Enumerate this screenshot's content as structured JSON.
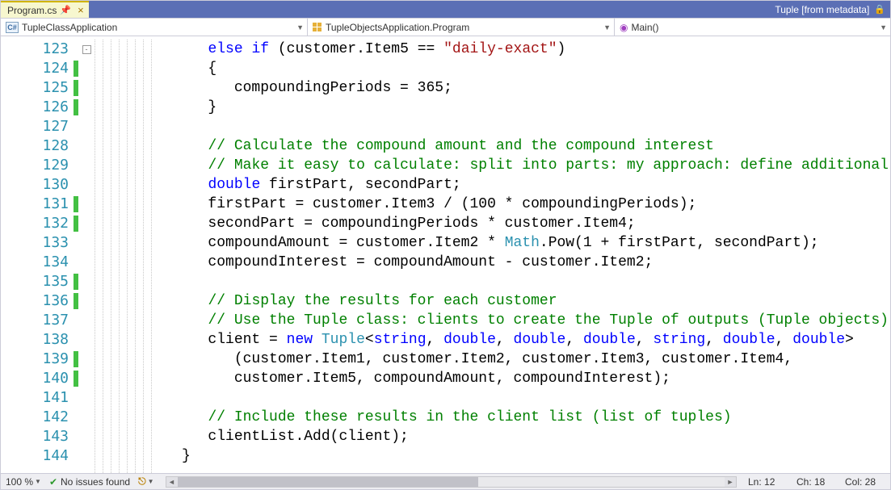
{
  "tab": {
    "filename": "Program.cs"
  },
  "titlebar_right": "Tuple [from metadata]",
  "nav": {
    "seg1": "TupleClassApplication",
    "seg2": "TupleObjectsApplication.Program",
    "seg3": "Main()"
  },
  "lines": {
    "start": 123,
    "end": 144,
    "marked": [
      124,
      125,
      126,
      131,
      132,
      135,
      136,
      139,
      140
    ]
  },
  "code": [
    {
      "tokens": [
        {
          "t": "             "
        },
        {
          "t": "else if",
          "c": "kw"
        },
        {
          "t": " (customer.Item5 == "
        },
        {
          "t": "\"daily-exact\"",
          "c": "str"
        },
        {
          "t": ")"
        }
      ]
    },
    {
      "tokens": [
        {
          "t": "             {"
        }
      ]
    },
    {
      "tokens": [
        {
          "t": "                compoundingPeriods = 365;"
        }
      ]
    },
    {
      "tokens": [
        {
          "t": "             }"
        }
      ]
    },
    {
      "tokens": [
        {
          "t": ""
        }
      ]
    },
    {
      "tokens": [
        {
          "t": "             "
        },
        {
          "t": "// Calculate the compound amount and the compound interest",
          "c": "cm"
        }
      ]
    },
    {
      "tokens": [
        {
          "t": "             "
        },
        {
          "t": "// Make it easy to calculate: split into parts: my approach: define additional fields here",
          "c": "cm"
        }
      ]
    },
    {
      "tokens": [
        {
          "t": "             "
        },
        {
          "t": "double",
          "c": "kw"
        },
        {
          "t": " firstPart, secondPart;"
        }
      ]
    },
    {
      "tokens": [
        {
          "t": "             firstPart = customer.Item3 / (100 * compoundingPeriods);"
        }
      ]
    },
    {
      "tokens": [
        {
          "t": "             secondPart = compoundingPeriods * customer.Item4;"
        }
      ]
    },
    {
      "tokens": [
        {
          "t": "             compoundAmount = customer.Item2 * "
        },
        {
          "t": "Math",
          "c": "typ"
        },
        {
          "t": ".Pow(1 + firstPart, secondPart);"
        }
      ]
    },
    {
      "tokens": [
        {
          "t": "             compoundInterest = compoundAmount - customer.Item2;"
        }
      ]
    },
    {
      "tokens": [
        {
          "t": ""
        }
      ]
    },
    {
      "tokens": [
        {
          "t": "             "
        },
        {
          "t": "// Display the results for each customer",
          "c": "cm"
        }
      ]
    },
    {
      "tokens": [
        {
          "t": "             "
        },
        {
          "t": "// Use the Tuple class: clients to create the Tuple of outputs (Tuple objects)",
          "c": "cm"
        }
      ]
    },
    {
      "tokens": [
        {
          "t": "             client = "
        },
        {
          "t": "new",
          "c": "kw"
        },
        {
          "t": " "
        },
        {
          "t": "Tuple",
          "c": "typ"
        },
        {
          "t": "<"
        },
        {
          "t": "string",
          "c": "kw"
        },
        {
          "t": ", "
        },
        {
          "t": "double",
          "c": "kw"
        },
        {
          "t": ", "
        },
        {
          "t": "double",
          "c": "kw"
        },
        {
          "t": ", "
        },
        {
          "t": "double",
          "c": "kw"
        },
        {
          "t": ", "
        },
        {
          "t": "string",
          "c": "kw"
        },
        {
          "t": ", "
        },
        {
          "t": "double",
          "c": "kw"
        },
        {
          "t": ", "
        },
        {
          "t": "double",
          "c": "kw"
        },
        {
          "t": ">"
        }
      ]
    },
    {
      "tokens": [
        {
          "t": "                (customer.Item1, customer.Item2, customer.Item3, customer.Item4,"
        }
      ]
    },
    {
      "tokens": [
        {
          "t": "                customer.Item5, compoundAmount, compoundInterest);"
        }
      ]
    },
    {
      "tokens": [
        {
          "t": ""
        }
      ]
    },
    {
      "tokens": [
        {
          "t": "             "
        },
        {
          "t": "// Include these results in the client list (list of tuples)",
          "c": "cm"
        }
      ]
    },
    {
      "tokens": [
        {
          "t": "             clientList.Add(client);"
        }
      ]
    },
    {
      "tokens": [
        {
          "t": "          }"
        }
      ]
    }
  ],
  "status": {
    "zoom": "100 %",
    "issues": "No issues found",
    "ln": "Ln: 12",
    "ch": "Ch: 18",
    "col": "Col: 28"
  }
}
